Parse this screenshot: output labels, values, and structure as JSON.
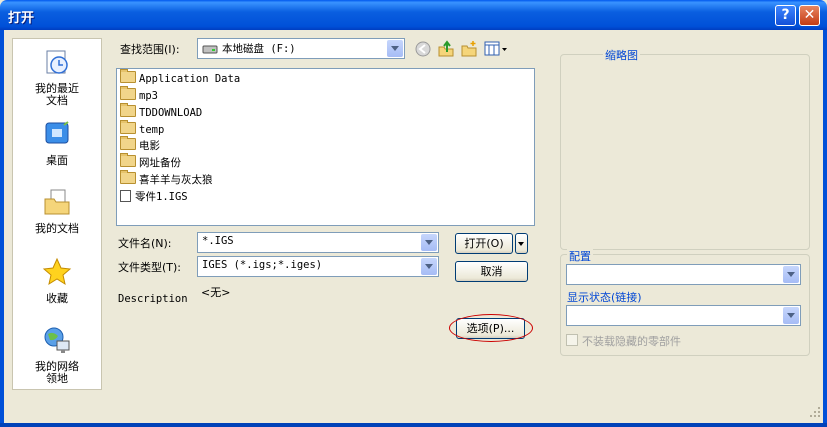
{
  "window": {
    "title": "打开",
    "help_glyph": "?",
    "close_glyph": "✕"
  },
  "places": [
    {
      "label": "我的最近文档",
      "icon": "recent-documents-icon"
    },
    {
      "label": "桌面",
      "icon": "desktop-icon"
    },
    {
      "label": "我的文档",
      "icon": "my-documents-icon"
    },
    {
      "label": "收藏",
      "icon": "favorites-star-icon"
    },
    {
      "label": "我的网络领地",
      "icon": "network-places-icon"
    }
  ],
  "lookin": {
    "label": "查找范围(I):",
    "value": "本地磁盘 (F:)"
  },
  "files": [
    {
      "name": "Application Data",
      "type": "folder"
    },
    {
      "name": "mp3",
      "type": "folder"
    },
    {
      "name": "TDDOWNLOAD",
      "type": "folder"
    },
    {
      "name": "temp",
      "type": "folder"
    },
    {
      "name": "电影",
      "type": "folder"
    },
    {
      "name": "网址备份",
      "type": "folder"
    },
    {
      "name": "喜羊羊与灰太狼",
      "type": "folder"
    },
    {
      "name": "零件1.IGS",
      "type": "file"
    }
  ],
  "filename": {
    "label": "文件名(N):",
    "value": "*.IGS"
  },
  "filetype": {
    "label": "文件类型(T):",
    "value": "IGES (*.igs;*.iges)"
  },
  "description": {
    "label": "Description",
    "value": "<无>"
  },
  "buttons": {
    "open": "打开(O)",
    "cancel": "取消",
    "options": "选项(P)..."
  },
  "preview": {
    "label": "缩略图"
  },
  "config": {
    "label": "配置",
    "value": ""
  },
  "display_state": {
    "label": "显示状态(链接)",
    "value": ""
  },
  "hide_parts": {
    "label": "不装载隐藏的零部件",
    "checked": false
  },
  "colors": {
    "title_bar": "#0054e3",
    "highlight_oval": "#cc0000",
    "dialog_bg": "#ece9d8"
  }
}
